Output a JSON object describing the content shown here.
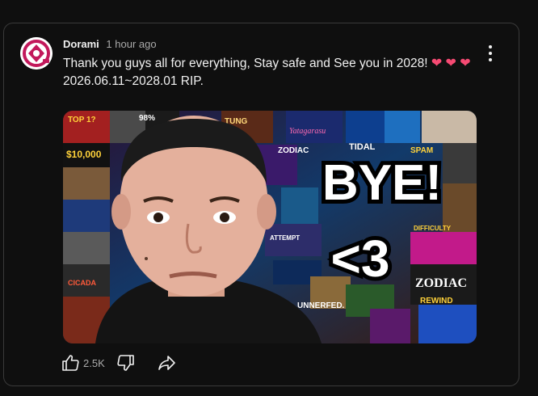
{
  "post": {
    "channel_name": "Dorami",
    "time_ago": "1 hour ago",
    "text_main": "Thank you guys all for everything, Stay safe and See you in 2028!",
    "text_date": "2026.06.11~2028.01 RIP.",
    "heart_glyph": "❤",
    "image_caption_main": "BYE!",
    "image_caption_sub": "<3",
    "tile_texts": [
      "TOP 1?",
      "98%",
      "TUNG",
      "Yatagarasu",
      "TIDAL",
      "$10,000",
      "ZODIAC",
      "SPAM",
      "DIFFICULTY",
      "CICADA",
      "UNNERFED.",
      "REWIND",
      "ZODIAC",
      "ATTEMPT"
    ]
  },
  "actions": {
    "like_count": "2.5K",
    "like_icon": "thumbs-up-icon",
    "dislike_icon": "thumbs-down-icon",
    "share_icon": "share-icon",
    "menu_icon": "more-vert-icon"
  },
  "colors": {
    "background": "#0f0f0f",
    "card_border": "#3a3a3a",
    "text_primary": "#f1f1f1",
    "text_secondary": "#aaaaaa",
    "heart": "#f64a73",
    "avatar_accent": "#c2185b"
  }
}
